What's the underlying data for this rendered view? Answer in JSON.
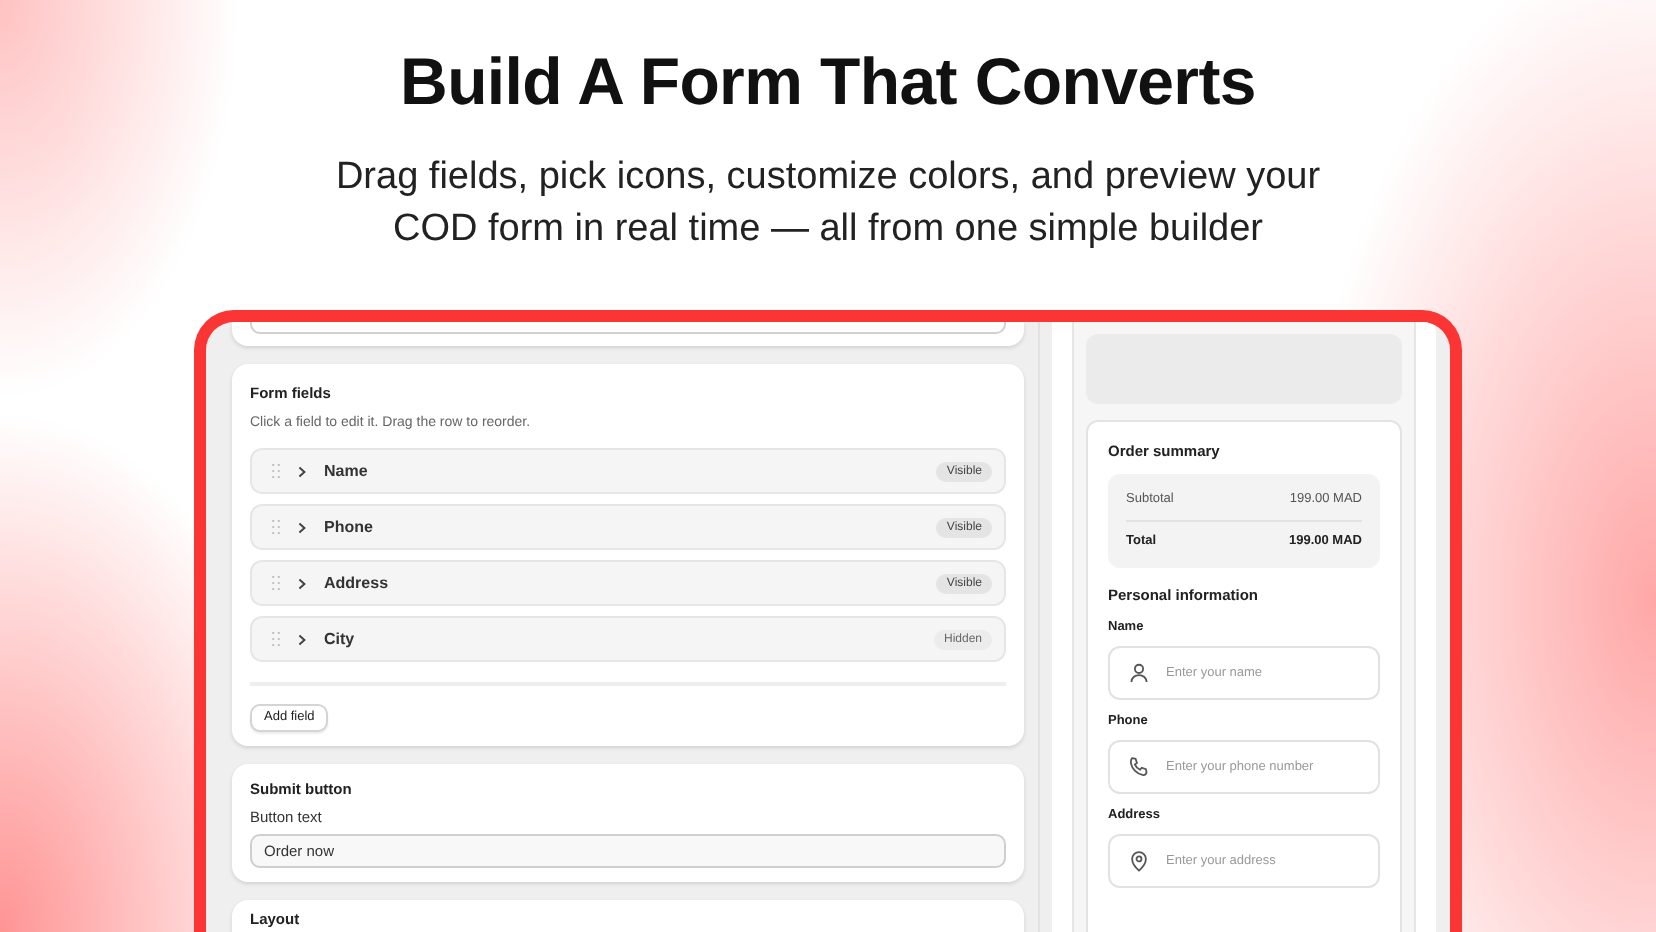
{
  "hero": {
    "title": "Build A Form That Converts",
    "subtitle_lines": [
      "Drag fields, pick icons, customize colors, and preview your",
      "COD form in real time — all from one simple builder"
    ]
  },
  "editor": {
    "form_fields": {
      "title": "Form fields",
      "hint": "Click a field to edit it. Drag the row to reorder.",
      "fields": [
        {
          "label": "Name",
          "status": "Visible",
          "visible": true
        },
        {
          "label": "Phone",
          "status": "Visible",
          "visible": true
        },
        {
          "label": "Address",
          "status": "Visible",
          "visible": true
        },
        {
          "label": "City",
          "status": "Hidden",
          "visible": false
        }
      ],
      "add_button": "Add field"
    },
    "submit_button": {
      "title": "Submit button",
      "label": "Button text",
      "value": "Order now"
    },
    "layout": {
      "title": "Layout"
    }
  },
  "preview": {
    "order_summary": {
      "title": "Order summary",
      "rows": [
        {
          "label": "Subtotal",
          "amount": "199.00 MAD",
          "kind": "subtotal"
        },
        {
          "label": "Total",
          "amount": "199.00 MAD",
          "kind": "total"
        }
      ]
    },
    "personal_information": {
      "title": "Personal information",
      "fields": [
        {
          "label": "Name",
          "placeholder": "Enter your name",
          "kind": "person"
        },
        {
          "label": "Phone",
          "placeholder": "Enter your phone number",
          "kind": "phone"
        },
        {
          "label": "Address",
          "placeholder": "Enter your address",
          "kind": "location"
        }
      ]
    }
  }
}
